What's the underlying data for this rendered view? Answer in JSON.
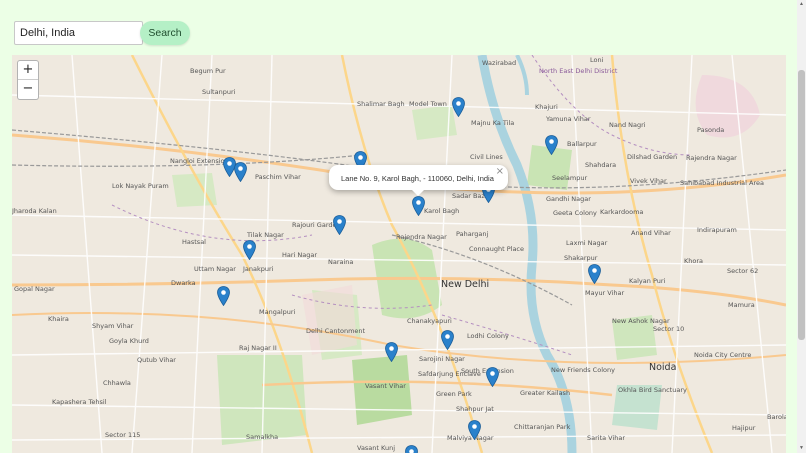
{
  "search": {
    "value": "Delhi, India",
    "button_label": "Search"
  },
  "map": {
    "zoom_in_label": "+",
    "zoom_out_label": "−",
    "popup_text": "Lane No. 9, Karol Bagh, ‐ 110060, Delhi, India",
    "popup_close": "×",
    "marker_color": "#2a81cb",
    "labels": [
      "Wazirabad",
      "Loni",
      "North East Delhi District",
      "Begum Pur",
      "Sultanpuri",
      "Shalimar Bagh",
      "Model Town",
      "Majnu Ka Tila",
      "Khajuri",
      "Yamuna Vihar",
      "Nand Nagri",
      "Pasonda",
      "Nangloi Extension",
      "Paschim Vihar",
      "Civil Lines",
      "Ballarpur",
      "Dilshad Garden",
      "Rajendra Nagar",
      "Lok Nayak Puram",
      "Seelampur",
      "Shahdara",
      "Vivek Vihar",
      "Sahibabad Industrial Area",
      "Jharoda Kalan",
      "Karol Bagh",
      "Sadar Bazar",
      "Gandhi Nagar",
      "Geeta Colony",
      "Karkardooma",
      "Hastsal",
      "Rajouri Garden",
      "Rajendra Nagar",
      "Paharganj",
      "Anand Vihar",
      "Tilak Nagar",
      "Laxmi Nagar",
      "Indirapuram",
      "Hari Nagar",
      "Naraina",
      "Connaught Place",
      "Shakarpur",
      "Uttam Nagar",
      "Janakpuri",
      "Khora",
      "Gopal Nagar",
      "New Delhi",
      "Sector 62",
      "Mayur Vihar",
      "Dwarka",
      "Kalyan Puri",
      "Khaira",
      "Mangalpuri",
      "Delhi Cantonment",
      "Chanakyapuri",
      "Mamura",
      "Shyam Vihar",
      "New Ashok Nagar",
      "Goyla Khurd",
      "Lodhi Colony",
      "Sector 10",
      "Raj Nagar II",
      "Qutub Vihar",
      "Sarojini Nagar",
      "Noida",
      "Noida City Centre",
      "Chhawla",
      "Safdarjung Enclave",
      "South Extension",
      "New Friends Colony",
      "Vasant Vihar",
      "Green Park",
      "Greater Kailash",
      "Okhla Bird Sanctuary",
      "Shahpur Jat",
      "Sector 115",
      "Samalkha",
      "Chittaranjan Park",
      "Malviya Nagar",
      "Vasant Kunj",
      "Sarita Vihar",
      "Kapashera Tehsil",
      "Hajipur",
      "Barola"
    ]
  }
}
